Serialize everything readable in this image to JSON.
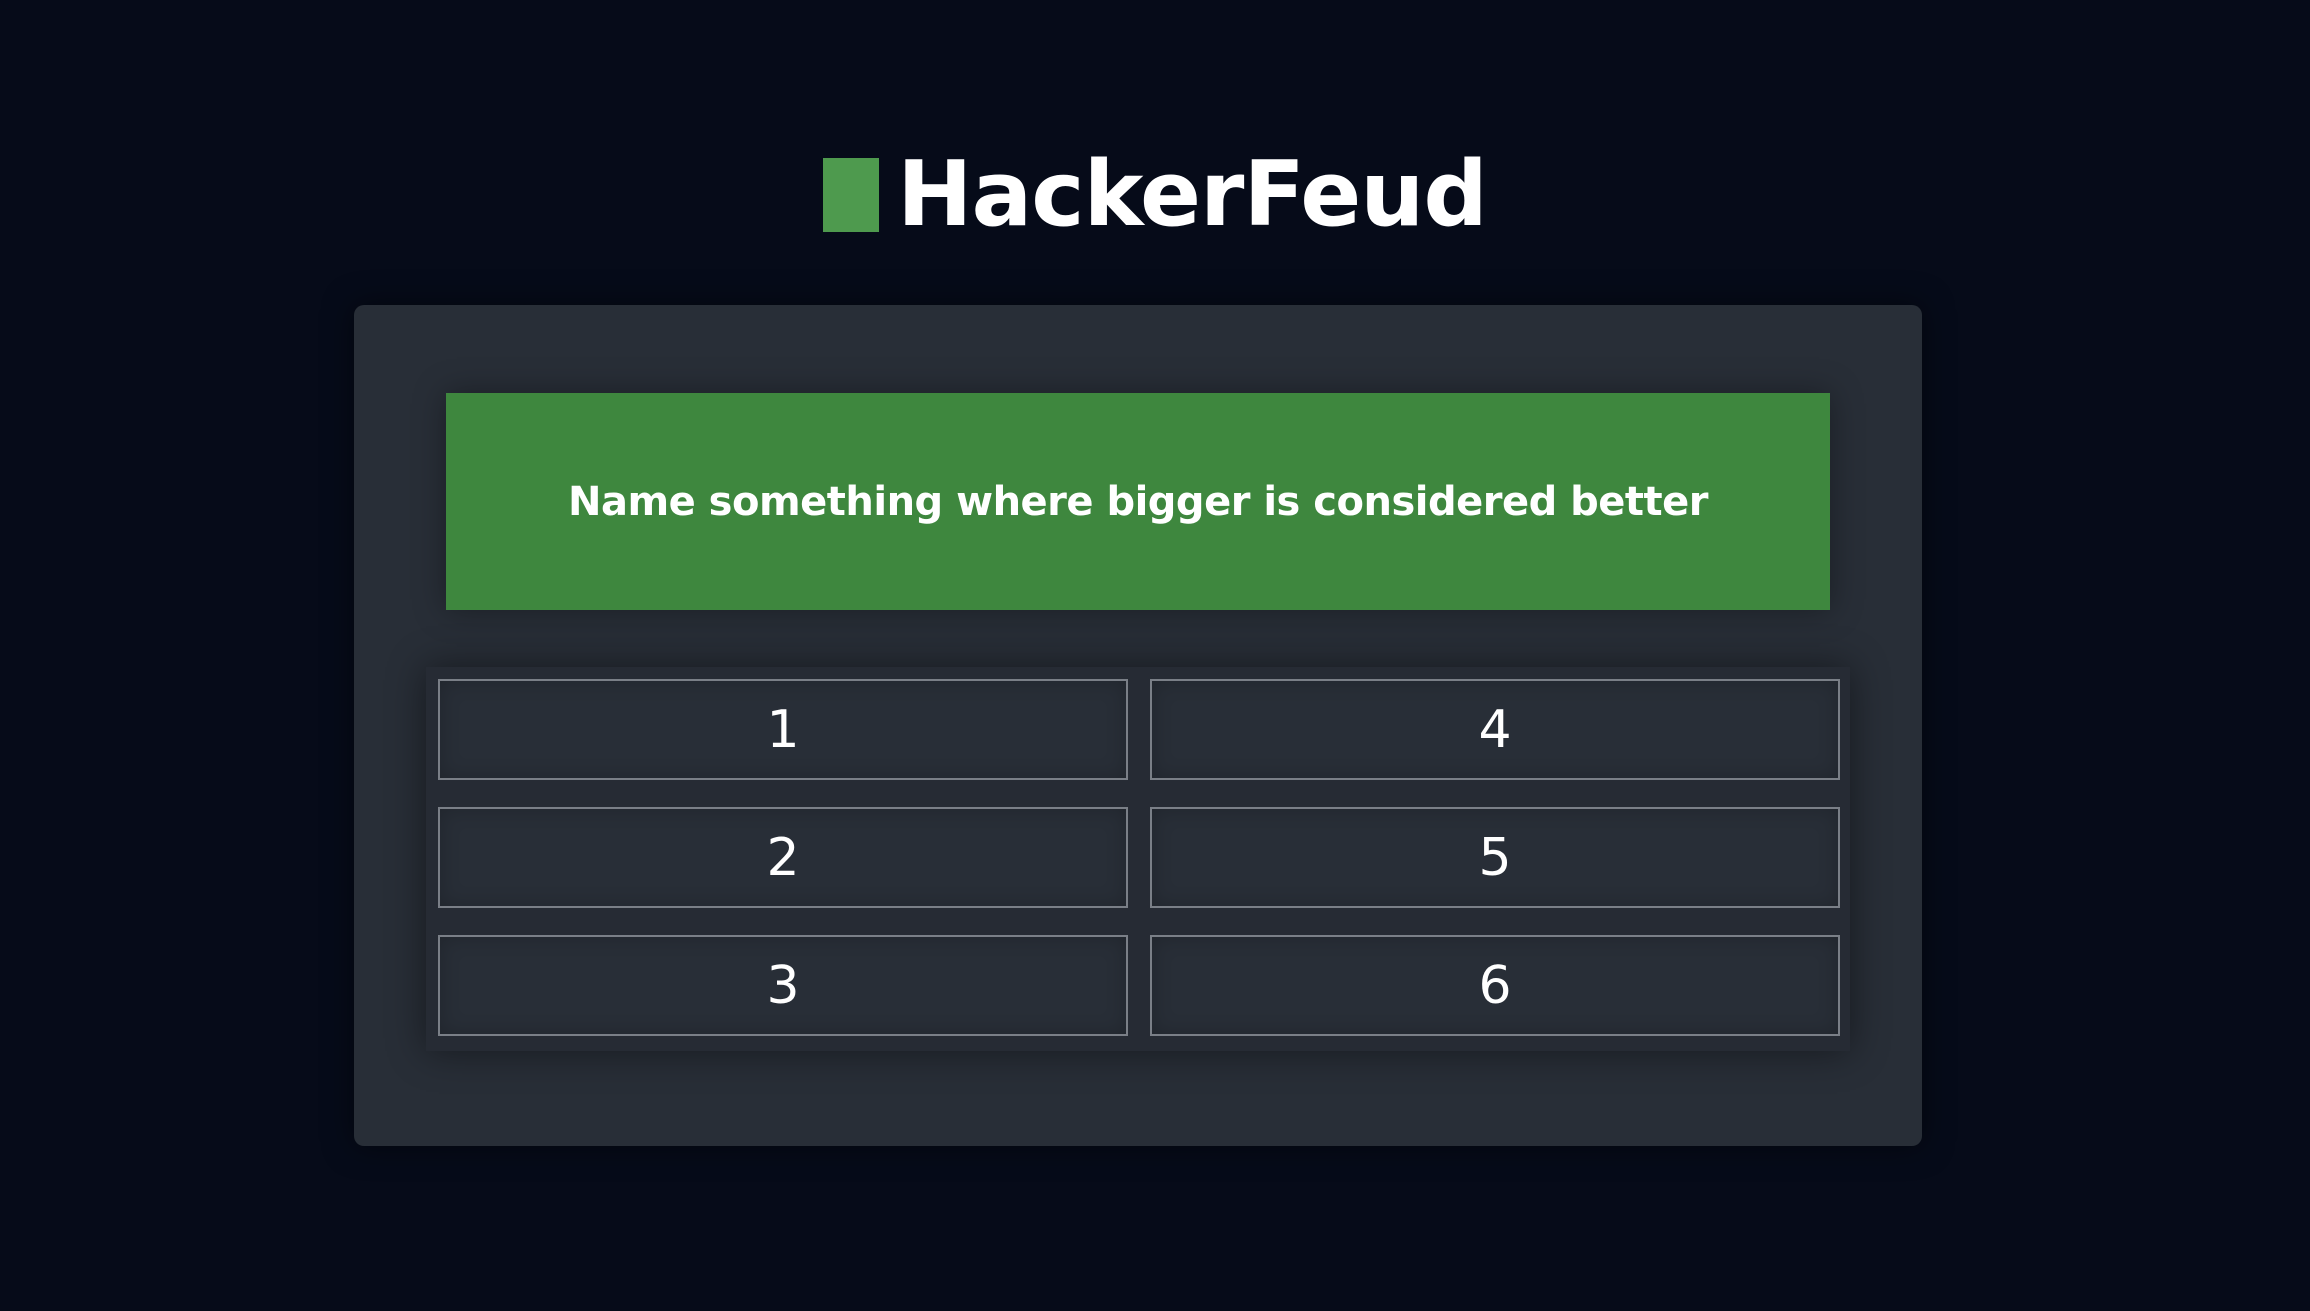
{
  "header": {
    "title": "HackerFeud",
    "logo_color": "#4e9a4e"
  },
  "question": {
    "text": "Name something where bigger is considered better",
    "background_color": "#3e873e"
  },
  "answers": [
    {
      "number": "1"
    },
    {
      "number": "2"
    },
    {
      "number": "3"
    },
    {
      "number": "4"
    },
    {
      "number": "5"
    },
    {
      "number": "6"
    }
  ],
  "colors": {
    "page_background": "#060b19",
    "panel_background": "#282e37",
    "slot_border": "#7a7f87"
  }
}
